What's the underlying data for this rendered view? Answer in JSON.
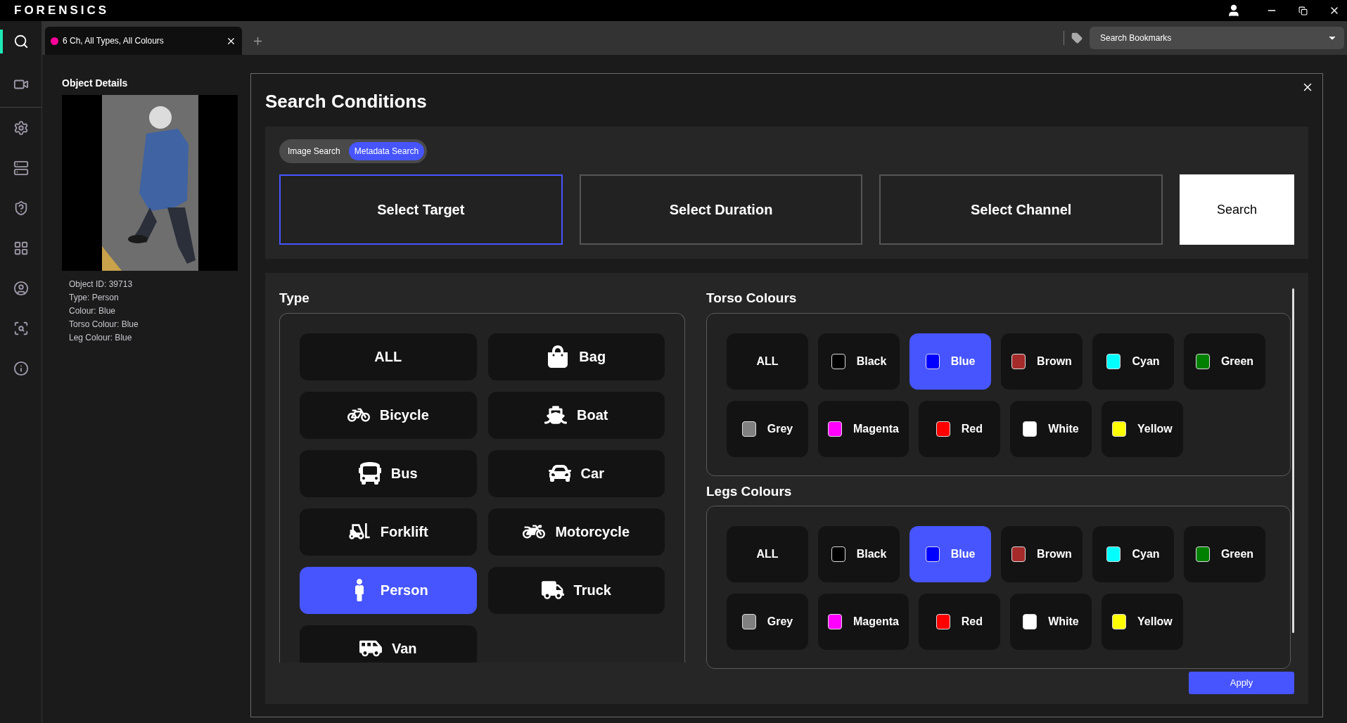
{
  "app": {
    "title": "FORENSICS"
  },
  "sidebar": {
    "items": [
      {
        "selected": true
      },
      {
        "selected": false
      },
      {
        "selected": false
      },
      {
        "selected": false
      },
      {
        "selected": false
      },
      {
        "selected": false
      },
      {
        "selected": false
      },
      {
        "selected": false
      },
      {
        "selected": false
      }
    ]
  },
  "tabs": [
    {
      "label": "6 Ch, All Types, All Colours",
      "color": "#ff0099",
      "selected": true
    }
  ],
  "bookmarks": {
    "placeholder": "Search Bookmarks"
  },
  "object_details": {
    "title": "Object Details",
    "lines": [
      "Object ID: 39713",
      "Type: Person",
      "Colour: Blue",
      "Torso Colour: Blue",
      "Leg Colour: Blue"
    ]
  },
  "search_conditions": {
    "title": "Search Conditions",
    "modes": [
      {
        "label": "Image Search",
        "selected": false
      },
      {
        "label": "Metadata Search",
        "selected": true
      }
    ],
    "steps": [
      {
        "label": "Select Target",
        "selected": true
      },
      {
        "label": "Select Duration",
        "selected": false
      },
      {
        "label": "Select Channel",
        "selected": false
      }
    ],
    "search_button": "Search",
    "type": {
      "title": "Type",
      "items": [
        {
          "label": "ALL",
          "selected": false
        },
        {
          "label": "Bag",
          "selected": false
        },
        {
          "label": "Bicycle",
          "selected": false
        },
        {
          "label": "Boat",
          "selected": false
        },
        {
          "label": "Bus",
          "selected": false
        },
        {
          "label": "Car",
          "selected": false
        },
        {
          "label": "Forklift",
          "selected": false
        },
        {
          "label": "Motorcycle",
          "selected": false
        },
        {
          "label": "Person",
          "selected": true
        },
        {
          "label": "Truck",
          "selected": false
        },
        {
          "label": "Van",
          "selected": false
        }
      ]
    },
    "torso": {
      "title": "Torso Colours",
      "items": [
        {
          "kind": "all",
          "label": "ALL",
          "selected": false
        },
        {
          "kind": "swatch",
          "label": "Black",
          "color": "#000000",
          "selected": false
        },
        {
          "kind": "swatch",
          "label": "Blue",
          "color": "#0000ff",
          "selected": true
        },
        {
          "kind": "swatch",
          "label": "Brown",
          "color": "#a52a2a",
          "selected": false
        },
        {
          "kind": "swatch",
          "label": "Cyan",
          "color": "#00ffff",
          "selected": false
        },
        {
          "kind": "swatch",
          "label": "Green",
          "color": "#008000",
          "selected": false
        },
        {
          "kind": "swatch",
          "label": "Grey",
          "color": "#808080",
          "selected": false
        },
        {
          "kind": "swatch",
          "label": "Magenta",
          "color": "#ff00ff",
          "selected": false
        },
        {
          "kind": "swatch",
          "label": "Red",
          "color": "#ff0000",
          "selected": false
        },
        {
          "kind": "swatch",
          "label": "White",
          "color": "#ffffff",
          "selected": false
        },
        {
          "kind": "swatch",
          "label": "Yellow",
          "color": "#ffff00",
          "selected": false
        }
      ]
    },
    "legs": {
      "title": "Legs Colours",
      "items": [
        {
          "kind": "all",
          "label": "ALL",
          "selected": false
        },
        {
          "kind": "swatch",
          "label": "Black",
          "color": "#000000",
          "selected": false
        },
        {
          "kind": "swatch",
          "label": "Blue",
          "color": "#0000ff",
          "selected": true
        },
        {
          "kind": "swatch",
          "label": "Brown",
          "color": "#a52a2a",
          "selected": false
        },
        {
          "kind": "swatch",
          "label": "Cyan",
          "color": "#00ffff",
          "selected": false
        },
        {
          "kind": "swatch",
          "label": "Green",
          "color": "#008000",
          "selected": false
        },
        {
          "kind": "swatch",
          "label": "Grey",
          "color": "#808080",
          "selected": false
        },
        {
          "kind": "swatch",
          "label": "Magenta",
          "color": "#ff00ff",
          "selected": false
        },
        {
          "kind": "swatch",
          "label": "Red",
          "color": "#ff0000",
          "selected": false
        },
        {
          "kind": "swatch",
          "label": "White",
          "color": "#ffffff",
          "selected": false
        },
        {
          "kind": "swatch",
          "label": "Yellow",
          "color": "#ffff00",
          "selected": false
        }
      ]
    },
    "apply_button": "Apply"
  }
}
